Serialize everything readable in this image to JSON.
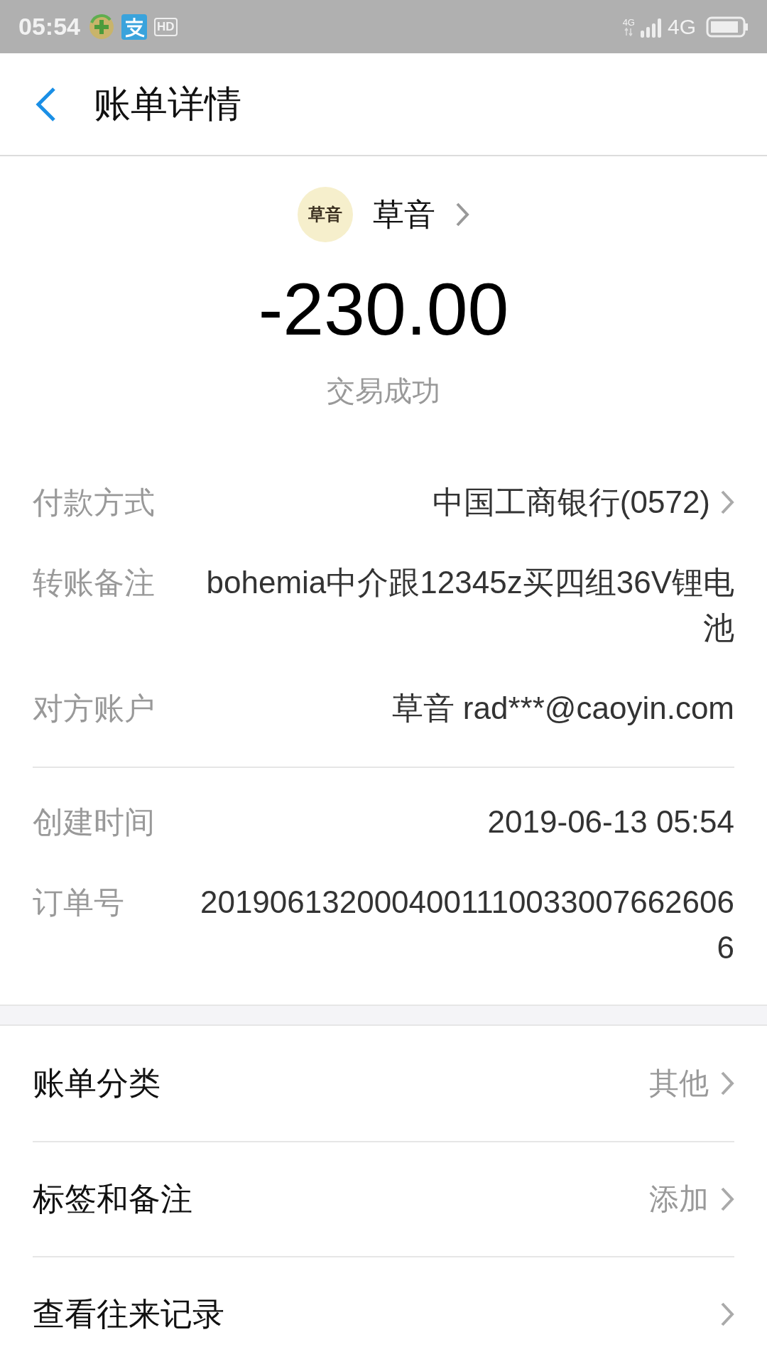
{
  "status_bar": {
    "time": "05:54",
    "hd_label": "HD",
    "network_small": "4G",
    "network": "4G"
  },
  "header": {
    "title": "账单详情"
  },
  "payee": {
    "avatar_text": "草音",
    "name": "草音",
    "amount": "-230.00",
    "status": "交易成功"
  },
  "detail_groups": [
    [
      {
        "label": "付款方式",
        "value": "中国工商银行(0572)",
        "link": true
      },
      {
        "label": "转账备注",
        "value": "bohemia中介跟12345z买四组36V锂电池",
        "link": false
      },
      {
        "label": "对方账户",
        "value": "草音 rad***@caoyin.com",
        "link": false
      }
    ],
    [
      {
        "label": "创建时间",
        "value": "2019-06-13 05:54",
        "link": false
      },
      {
        "label": "订单号",
        "value": "20190613200040011100330076626066",
        "link": false
      }
    ]
  ],
  "actions": [
    {
      "label": "账单分类",
      "value": "其他"
    },
    {
      "label": "标签和备注",
      "value": "添加"
    },
    {
      "label": "查看往来记录"
    }
  ]
}
